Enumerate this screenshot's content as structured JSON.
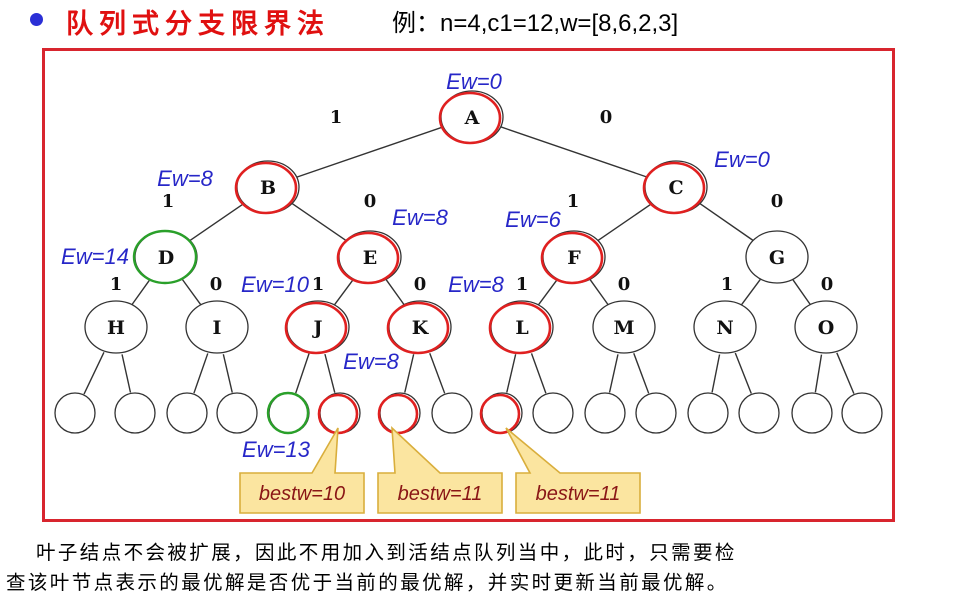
{
  "header": {
    "title": "队列式分支限界法",
    "example": "例：n=4,c1=12,w=[8,6,2,3]"
  },
  "colors": {
    "bullet": "#2b2fd6",
    "title": "#e01010",
    "frame": "#d8252e",
    "annotation": "#2727c8",
    "red_node": "#e02020",
    "green_node": "#2aa02a",
    "callout_fill": "#fbe5a0",
    "callout_border": "#d9ae3c",
    "callout_text": "#8a1616"
  },
  "tree": {
    "nodes": [
      {
        "id": "A",
        "label": "A",
        "state": "red"
      },
      {
        "id": "B",
        "label": "B",
        "state": "red"
      },
      {
        "id": "C",
        "label": "C",
        "state": "red"
      },
      {
        "id": "D",
        "label": "D",
        "state": "green"
      },
      {
        "id": "E",
        "label": "E",
        "state": "red"
      },
      {
        "id": "F",
        "label": "F",
        "state": "red"
      },
      {
        "id": "G",
        "label": "G",
        "state": "plain"
      },
      {
        "id": "H",
        "label": "H",
        "state": "plain"
      },
      {
        "id": "I",
        "label": "I",
        "state": "plain"
      },
      {
        "id": "J",
        "label": "J",
        "state": "red"
      },
      {
        "id": "K",
        "label": "K",
        "state": "red"
      },
      {
        "id": "L",
        "label": "L",
        "state": "red"
      },
      {
        "id": "M",
        "label": "M",
        "state": "plain"
      },
      {
        "id": "N",
        "label": "N",
        "state": "plain"
      },
      {
        "id": "O",
        "label": "O",
        "state": "plain"
      },
      {
        "id": "leaf1",
        "label": "",
        "state": "plain"
      },
      {
        "id": "leaf2",
        "label": "",
        "state": "plain"
      },
      {
        "id": "leaf3",
        "label": "",
        "state": "plain"
      },
      {
        "id": "leaf4",
        "label": "",
        "state": "plain"
      },
      {
        "id": "leaf5",
        "label": "",
        "state": "green"
      },
      {
        "id": "leaf6",
        "label": "",
        "state": "red"
      },
      {
        "id": "leaf7",
        "label": "",
        "state": "red"
      },
      {
        "id": "leaf8",
        "label": "",
        "state": "plain"
      },
      {
        "id": "leaf9",
        "label": "",
        "state": "red"
      },
      {
        "id": "leaf10",
        "label": "",
        "state": "plain"
      },
      {
        "id": "leaf11",
        "label": "",
        "state": "plain"
      },
      {
        "id": "leaf12",
        "label": "",
        "state": "plain"
      },
      {
        "id": "leaf13",
        "label": "",
        "state": "plain"
      },
      {
        "id": "leaf14",
        "label": "",
        "state": "plain"
      },
      {
        "id": "leaf15",
        "label": "",
        "state": "plain"
      },
      {
        "id": "leaf16",
        "label": "",
        "state": "plain"
      }
    ],
    "edge_labels": [
      "1",
      "0",
      "1",
      "0",
      "1",
      "0",
      "1",
      "0",
      "1",
      "0",
      "1",
      "0",
      "1",
      "0"
    ],
    "annotations": [
      "Ew=0",
      "Ew=8",
      "Ew=0",
      "Ew=14",
      "Ew=8",
      "Ew=6",
      "Ew=10",
      "Ew=8",
      "Ew=8",
      "Ew=13"
    ],
    "callouts": [
      "bestw=10",
      "bestw=11",
      "bestw=11"
    ]
  },
  "caption": {
    "line1": "叶子结点不会被扩展，因此不用加入到活结点队列当中，此时，只需要检",
    "line2": "查该叶节点表示的最优解是否优于当前的最优解，并实时更新当前最优解。"
  }
}
